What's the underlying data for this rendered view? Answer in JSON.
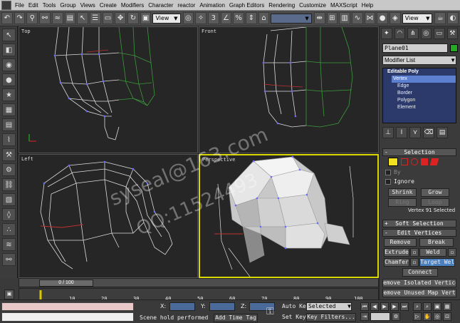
{
  "menubar": {
    "items": [
      "File",
      "Edit",
      "Tools",
      "Group",
      "Views",
      "Create",
      "Modifiers",
      "Character",
      "reactor",
      "Animation",
      "Graph Editors",
      "Rendering",
      "Customize",
      "MAXScript",
      "Help"
    ]
  },
  "toolbar": {
    "view_dropdown": "View",
    "view_dropdown_right": "View"
  },
  "viewports": {
    "top": "Top",
    "front": "Front",
    "left": "Left",
    "perspective": "Perspective"
  },
  "watermark": {
    "line1": "syseal@163.com",
    "line2": "QQ:11524493"
  },
  "command_panel": {
    "object_name": "Plane01",
    "object_color": "#22aa22",
    "modifier_list": "Modifier List",
    "stack": {
      "top": "Editable Poly",
      "items": [
        "Vertex",
        "Edge",
        "Border",
        "Polygon",
        "Element"
      ],
      "selected": "Vertex"
    },
    "selection": {
      "header": "Selection",
      "by_label": "By",
      "ignore_label": "Ignore",
      "shrink": "Shrink",
      "grow": "Grow",
      "ring": "Ring",
      "loop": "Loop",
      "status": "Vertex 91 Selected"
    },
    "soft_selection_header": "Soft Selection",
    "edit_vertices": {
      "header": "Edit Vertices",
      "remove": "Remove",
      "break": "Break",
      "extrude": "Extrude",
      "weld": "Weld",
      "chamfer": "Chamfer",
      "target_weld": "Target Weld",
      "connect": "Connect",
      "remove_isolated": "emove Isolated Vertice",
      "remove_unused": "emove Unused Map Vert"
    }
  },
  "timeline": {
    "frame": "0 / 100",
    "ticks": [
      "10",
      "20",
      "30",
      "40",
      "50",
      "60",
      "70",
      "80",
      "90",
      "100"
    ]
  },
  "statusbar": {
    "x_label": "X:",
    "y_label": "Y:",
    "z_label": "Z:",
    "auto_key": "Auto Key",
    "selected": "Selected",
    "set_key": "Set Key",
    "key_filters": "Key Filters...",
    "scene_hold": "Scene hold performed",
    "add_time_tag": "Add Time Tag"
  }
}
